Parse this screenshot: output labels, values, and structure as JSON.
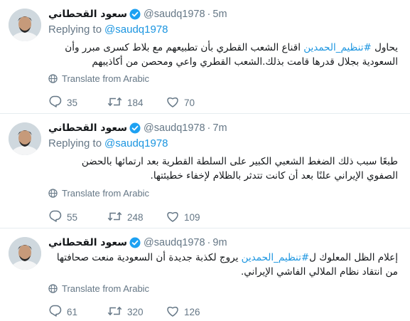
{
  "colors": {
    "link": "#1b95e0",
    "muted": "#657786",
    "verified_badge": "#1da1f2",
    "divider": "#e6ecf0"
  },
  "translate_icon": "globe-icon",
  "action_icons": [
    "reply-icon",
    "retweet-icon",
    "like-icon",
    "more-icon"
  ],
  "tweets": [
    {
      "display_name": "سعود القحطاني",
      "handle": "@saudq1978",
      "separator": "·",
      "time": "5m",
      "replying_label": "Replying to",
      "replying_to": "@saudq1978",
      "text_before": "يحاول ",
      "hashtag": "#تنظيم_الحمدين",
      "text_after": " اقناع الشعب القطري بأن تطبيعهم مع بلاط كسرى مبرر وأن السعودية بجلال قدرها قامت بذلك.الشعب القطري واعي ومحصن من أكاذيبهم",
      "translate_label": "Translate from Arabic",
      "replies": "35",
      "retweets": "184",
      "likes": "70"
    },
    {
      "display_name": "سعود القحطاني",
      "handle": "@saudq1978",
      "separator": "·",
      "time": "7m",
      "replying_label": "Replying to",
      "replying_to": "@saudq1978",
      "text_before": "طبعًا سبب ذلك الضغط الشعبي الكبير على السلطة القطرية بعد ارتمائها بالحضن الصفوي الإيراني علنًا بعد أن كانت تتدثر بالظلام لإخفاء خطيئتها.",
      "hashtag": "",
      "text_after": "",
      "translate_label": "Translate from Arabic",
      "replies": "55",
      "retweets": "248",
      "likes": "109"
    },
    {
      "display_name": "سعود القحطاني",
      "handle": "@saudq1978",
      "separator": "·",
      "time": "9m",
      "replying_label": "",
      "replying_to": "",
      "text_before": "إعلام الظل المعلوك ل",
      "hashtag": "#تنظيم_الحمدين",
      "text_after": " يروج لكذبة جديدة أن السعودية منعت صحافتها من انتقاد نظام الملالي الفاشي الإيراني.",
      "translate_label": "Translate from Arabic",
      "replies": "61",
      "retweets": "320",
      "likes": "126"
    }
  ]
}
